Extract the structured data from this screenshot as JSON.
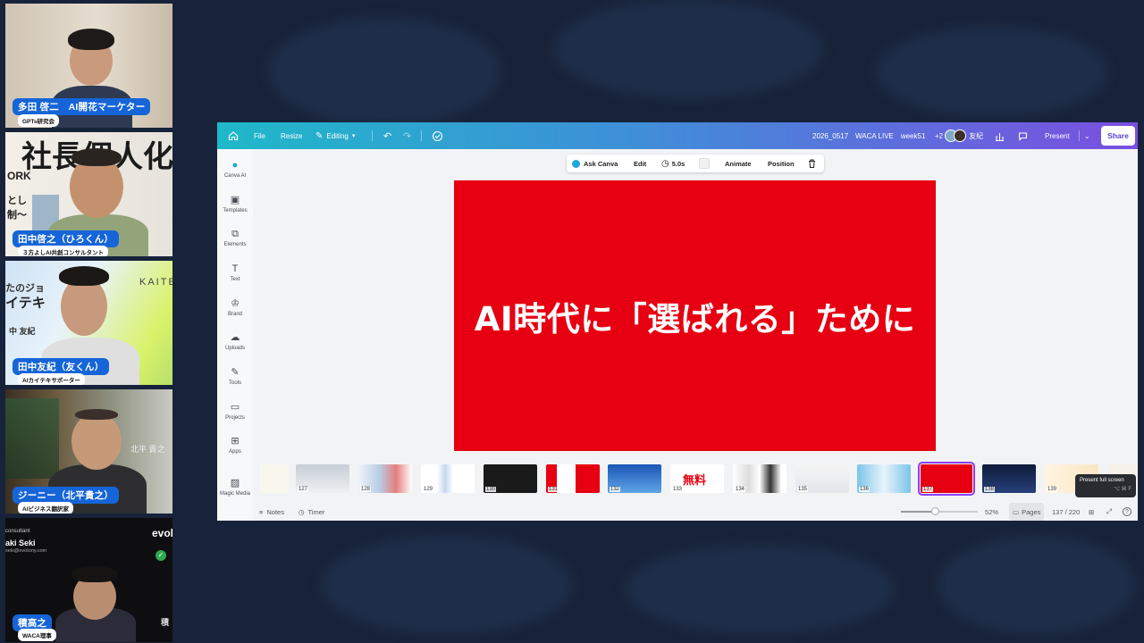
{
  "participants": [
    {
      "name": "多田 啓二　AI開花マーケター",
      "role": "GPTs研究会"
    },
    {
      "name": "田中啓之（ひろくん）",
      "role": "３方よしAI共創コンサルタント"
    },
    {
      "name": "田中友紀（友くん）",
      "role": "AIカイテキサポーター"
    },
    {
      "name": "ジーニー（北平貴之）",
      "role": "AIビジネス翻訳家"
    },
    {
      "name": "積高之",
      "role": "WACA理事"
    }
  ],
  "tile_texts": {
    "t2_big": "社長個人化",
    "t2_small": "ORK",
    "t2_lines": "とし\n制〜",
    "t3_kaite": "KAITE",
    "t3_jo": "たのジョ",
    "t3_iteki": "イテキ",
    "t3_name": "中 友紀",
    "t4_name": "北平 貴之",
    "t5_consult": "consultant",
    "t5_name": "aki Seki",
    "t5_mail": "seki@evotony.com",
    "t5_logo": "evol",
    "t5_side": "積"
  },
  "topbar": {
    "file": "File",
    "resize": "Resize",
    "editing": "Editing",
    "doc_title": "2026_0517　WACA LIVE　week51",
    "collab_count": "+2",
    "collab_name": "友紀",
    "present": "Present",
    "share": "Share"
  },
  "sidebar": [
    {
      "label": "Canva AI",
      "icon": "canva-ai-icon"
    },
    {
      "label": "Templates",
      "icon": "templates-icon"
    },
    {
      "label": "Elements",
      "icon": "elements-icon"
    },
    {
      "label": "Text",
      "icon": "text-icon"
    },
    {
      "label": "Brand",
      "icon": "brand-icon"
    },
    {
      "label": "Uploads",
      "icon": "uploads-icon"
    },
    {
      "label": "Tools",
      "icon": "tools-icon"
    },
    {
      "label": "Projects",
      "icon": "projects-icon"
    },
    {
      "label": "Apps",
      "icon": "apps-icon"
    },
    {
      "label": "Magic Media",
      "icon": "magic-media-icon"
    }
  ],
  "context_toolbar": {
    "ask_canva": "Ask Canva",
    "edit": "Edit",
    "duration": "5.0s",
    "animate": "Animate",
    "position": "Position"
  },
  "slide": {
    "text": "AI時代に「選ばれる」ために",
    "bg_color": "#e60012"
  },
  "filmstrip": {
    "thumbs": [
      {
        "num": "",
        "label": ""
      },
      {
        "num": "127",
        "label": ""
      },
      {
        "num": "128",
        "label": ""
      },
      {
        "num": "129",
        "label": ""
      },
      {
        "num": "130",
        "label": ""
      },
      {
        "num": "131",
        "label": ""
      },
      {
        "num": "132",
        "label": ""
      },
      {
        "num": "133",
        "label": "無料"
      },
      {
        "num": "134",
        "label": ""
      },
      {
        "num": "135",
        "label": ""
      },
      {
        "num": "136",
        "label": ""
      },
      {
        "num": "137",
        "label": ""
      },
      {
        "num": "138",
        "label": ""
      },
      {
        "num": "139",
        "label": ""
      },
      {
        "num": "",
        "label": ""
      }
    ],
    "selected": "137"
  },
  "bottombar": {
    "notes": "Notes",
    "timer": "Timer",
    "zoom": "52%",
    "pages": "Pages",
    "page_count": "137 / 220"
  },
  "tooltip": {
    "text": "Present full screen",
    "shortcut": "⌥ ⌘ F"
  }
}
